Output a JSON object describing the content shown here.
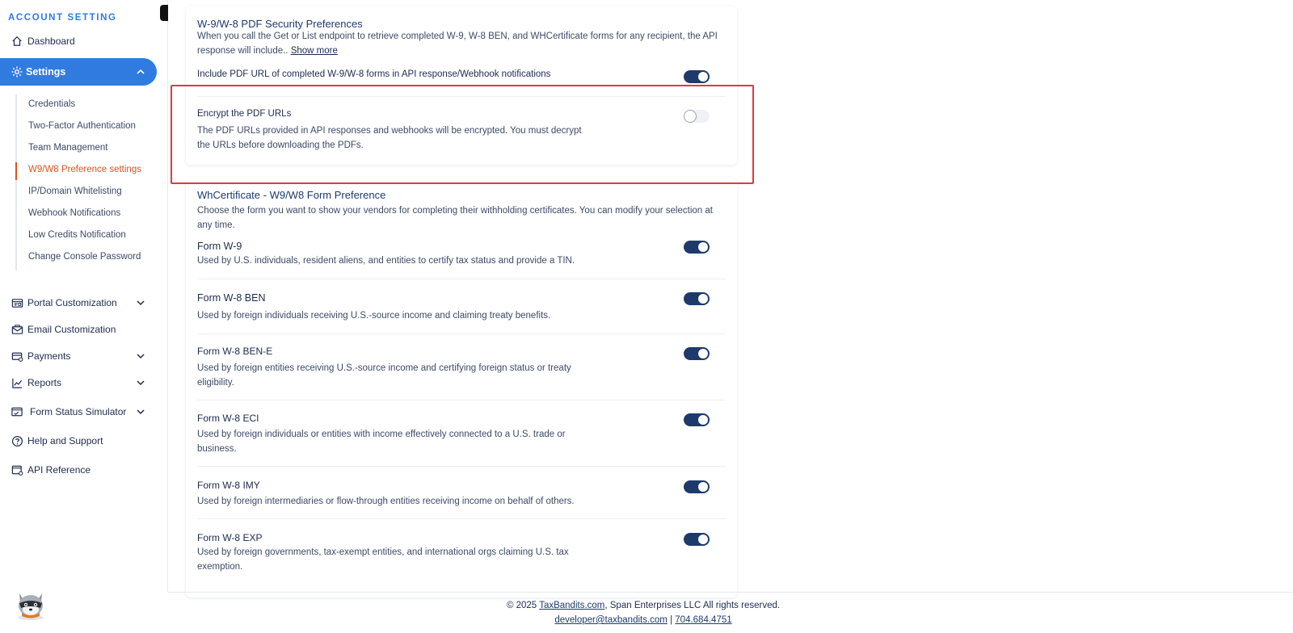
{
  "sidebar": {
    "heading": "ACCOUNT SETTING",
    "dashboard": "Dashboard",
    "settings": "Settings",
    "sub_items": [
      "Credentials",
      "Two-Factor Authentication",
      "Team Management",
      "W9/W8 Preference settings",
      "IP/Domain Whitelisting",
      "Webhook Notifications",
      "Low Credits Notification",
      "Change Console Password"
    ],
    "active_sub_item": "W9/W8 Preference settings",
    "lower_items": [
      {
        "label": "Portal Customization",
        "icon": "layout-icon",
        "expandable": true
      },
      {
        "label": "Email Customization",
        "icon": "mail-icon",
        "expandable": false
      },
      {
        "label": "Payments",
        "icon": "payment-icon",
        "expandable": true
      },
      {
        "label": "Reports",
        "icon": "chart-icon",
        "expandable": true
      },
      {
        "label": "Form Status Simulator",
        "icon": "simulator-icon",
        "expandable": true
      },
      {
        "label": "Help and Support",
        "icon": "help-icon",
        "expandable": false
      },
      {
        "label": "API Reference",
        "icon": "api-icon",
        "expandable": false
      }
    ]
  },
  "security_card": {
    "title": "W-9/W-8 PDF Security Preferences",
    "desc_line1": "When you call the Get or List endpoint to retrieve completed W-9, W-8 BEN, and WHCertificate forms for any recipient, the API",
    "desc_line2": "response will include..",
    "show_more": "Show more",
    "include_pdf_label": "Include PDF URL of completed W-9/W-8 forms in API response/Webhook notifications",
    "include_pdf_enabled": true,
    "encrypt_title": "Encrypt the PDF URLs",
    "encrypt_desc_line1": "The PDF URLs provided in API responses and webhooks will be encrypted. You must decrypt",
    "encrypt_desc_line2": "the URLs before downloading the PDFs.",
    "encrypt_enabled": false
  },
  "form_card": {
    "title": "WhCertificate - W9/W8 Form Preference",
    "desc_line1": "Choose the form you want to show your vendors for completing their withholding certificates. You can modify your selection at",
    "desc_line2": "any time.",
    "forms": [
      {
        "title": "Form W-9",
        "desc1": "Used by U.S. individuals, resident aliens, and entities to certify tax status and provide a TIN.",
        "desc2": "",
        "enabled": true
      },
      {
        "title": "Form W-8 BEN",
        "desc1": "Used by foreign individuals receiving U.S.-source income and claiming treaty benefits.",
        "desc2": "",
        "enabled": true
      },
      {
        "title": "Form W-8 BEN-E",
        "desc1": "Used by foreign entities receiving U.S.-source income and certifying foreign status or treaty",
        "desc2": "eligibility.",
        "enabled": true
      },
      {
        "title": "Form W-8 ECI",
        "desc1": "Used by foreign individuals or entities with income effectively connected to a U.S. trade or",
        "desc2": "business.",
        "enabled": true
      },
      {
        "title": "Form W-8 IMY",
        "desc1": "Used by foreign intermediaries or flow-through entities receiving income on behalf of others.",
        "desc2": "",
        "enabled": true
      },
      {
        "title": "Form W-8 EXP",
        "desc1": "Used by foreign governments, tax-exempt entities, and international orgs claiming U.S. tax",
        "desc2": "exemption.",
        "enabled": true
      }
    ]
  },
  "footer": {
    "copyright_prefix": "© 2025 ",
    "site_link": "TaxBandits.com",
    "copyright_suffix": ", Span Enterprises LLC All rights reserved.",
    "email": "developer@taxbandits.com",
    "separator": " | ",
    "phone": "704.684.4751"
  },
  "colors": {
    "accent": "#2f7be0",
    "active_sub": "#d9541f",
    "toggle_on": "#1e3a6b",
    "highlight": "#e03a3a"
  }
}
